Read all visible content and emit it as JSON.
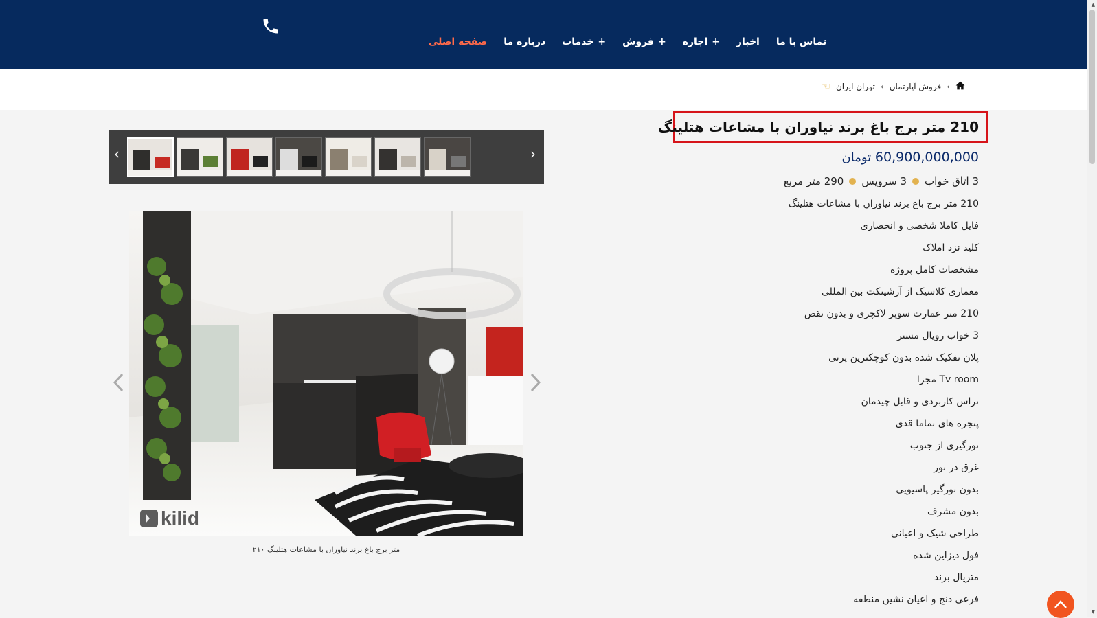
{
  "header": {
    "nav": [
      {
        "label": "صفحه اصلی",
        "active": true,
        "plus": false
      },
      {
        "label": "درباره ما",
        "active": false,
        "plus": false
      },
      {
        "label": "خدمات",
        "active": false,
        "plus": true
      },
      {
        "label": "فروش",
        "active": false,
        "plus": true
      },
      {
        "label": "اجاره",
        "active": false,
        "plus": true
      },
      {
        "label": "اخبار",
        "active": false,
        "plus": false
      },
      {
        "label": "تماس با ما",
        "active": false,
        "plus": false
      }
    ],
    "plus_symbol": "+",
    "phone_icon": "phone-icon",
    "colors": {
      "bg": "#062a5e",
      "active": "#ff6a4a"
    }
  },
  "breadcrumb": {
    "home_icon": "home-icon",
    "sep": "›",
    "items": [
      "فروش آپارتمان",
      "تهران ایران"
    ],
    "hand_icon": "hand-pointing-icon"
  },
  "listing": {
    "title": "210 متر برج باغ برند نیاوران با مشاعات هتلینگ",
    "price_value": "60,900,000,000",
    "price_unit": "تومان",
    "specs": {
      "bedrooms": "3 اتاق خواب",
      "bathrooms": "3 سرویس",
      "area": "290 متر مربع"
    },
    "features": [
      "210 متر برج باغ برند نیاوران با مشاعات هتلینگ",
      "فایل کاملا شخصی و انحصاری",
      "کلید نزد املاک",
      "مشخصات کامل پروژه",
      "معماری کلاسیک از آرشیتکت بین المللی",
      "210 متر عمارت سوپر لاکچری و بدون نقص",
      "3 خواب رویال مستر",
      "پلان تفکیک شده بدون کوچکترین پرتی",
      "Tv room مجزا",
      "تراس کاربردی و قابل چیدمان",
      "پنجره های تماما قدی",
      "نورگیری از جنوب",
      "غرق در نور",
      "بدون نورگیر پاسیویی",
      "بدون مشرف",
      "طراحی شیک و اعیانی",
      "فول دیزاین شده",
      "متریال برند",
      "فرعی دنج و اعیان نشین منطقه"
    ]
  },
  "gallery": {
    "thumbs": 7,
    "active_index": 0,
    "watermark": "kilid",
    "caption": "متر برج باغ برند نیاوران با مشاعات هتلینگ ۲۱۰",
    "prev_symbol": "‹",
    "next_symbol": "›"
  }
}
